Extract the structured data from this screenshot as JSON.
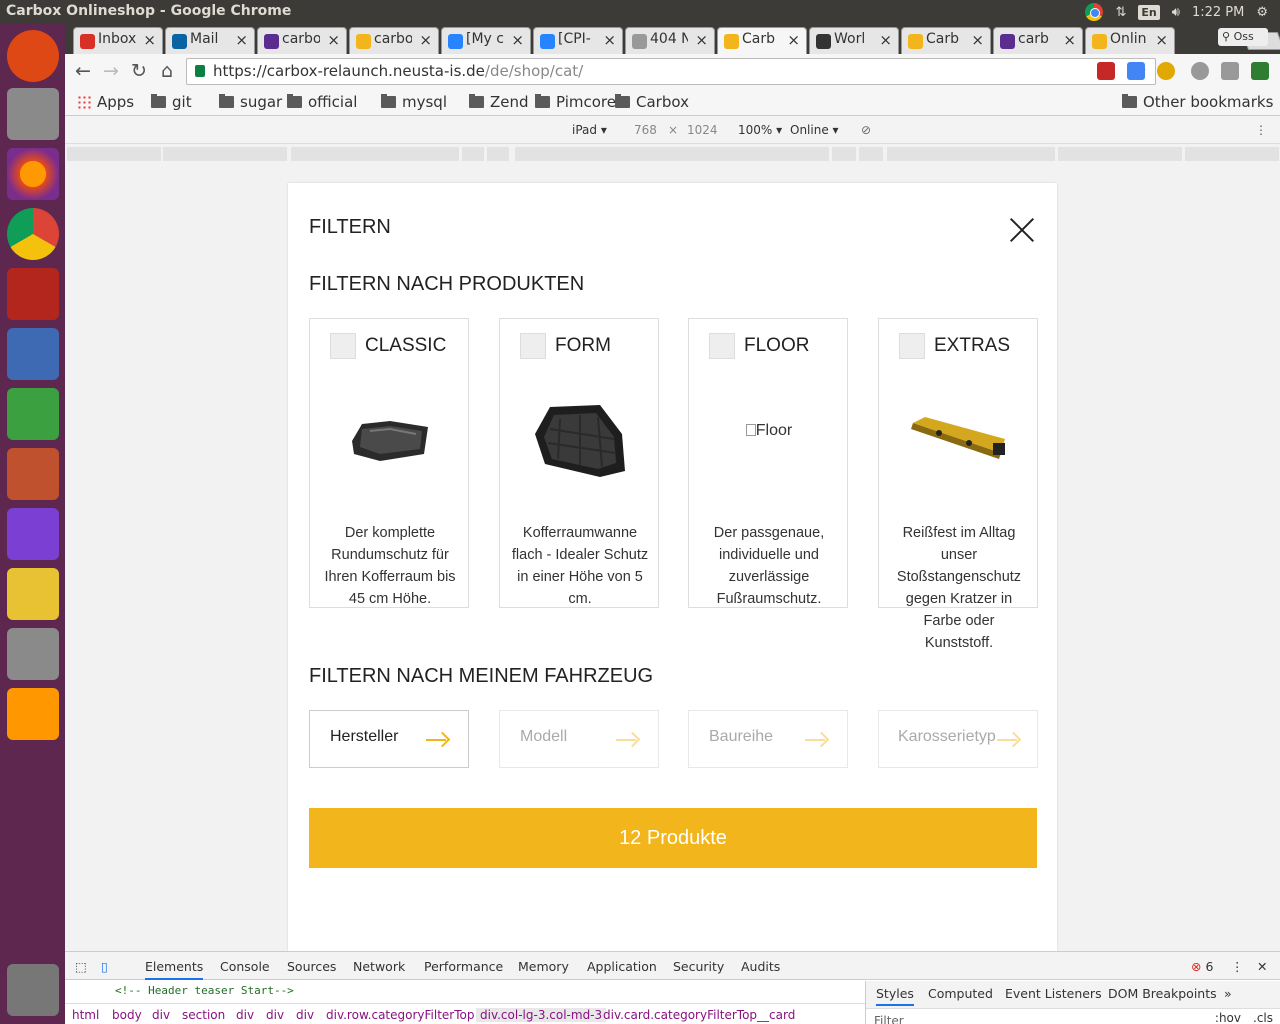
{
  "os": {
    "window_title": "Carbox Onlineshop - Google Chrome",
    "keyboard": "En",
    "time": "1:22 PM"
  },
  "tabs": [
    {
      "label": "Inbox",
      "color": "#d93025"
    },
    {
      "label": "Mail",
      "color": "#0a64a4"
    },
    {
      "label": "carbox",
      "color": "#5c2d91"
    },
    {
      "label": "carbox",
      "color": "#f2b61c"
    },
    {
      "label": "[My c",
      "color": "#2684ff"
    },
    {
      "label": "[CPI-",
      "color": "#2684ff"
    },
    {
      "label": "404 N",
      "color": "#999999"
    },
    {
      "label": "Carb",
      "color": "#f2b61c"
    },
    {
      "label": "Worl",
      "color": "#333333"
    },
    {
      "label": "Carb",
      "color": "#f2b61c"
    },
    {
      "label": "carb",
      "color": "#5c2d91"
    },
    {
      "label": "Onlin",
      "color": "#f2b61c"
    }
  ],
  "profile": "Oss",
  "omnibox": {
    "host": "https://carbox-relaunch.neusta-is.de",
    "path": "/de/shop/cat/"
  },
  "bookmarks": {
    "apps": "Apps",
    "folders": [
      "git",
      "sugar",
      "official",
      "mysql",
      "Zend",
      "Pimcore",
      "Carbox"
    ],
    "other": "Other bookmarks"
  },
  "device_toolbar": {
    "device": "iPad",
    "width": "768",
    "times": "×",
    "height": "1024",
    "zoom": "100%",
    "network": "Online"
  },
  "filter": {
    "title": "FILTERN",
    "products_heading": "FILTERN NACH PRODUKTEN",
    "products": [
      {
        "name": "CLASSIC",
        "description": "Der komplette Rundumschutz für Ihren Kofferraum bis 45 cm Höhe."
      },
      {
        "name": "FORM",
        "description": "Kofferraumwanne flach - Idealer Schutz in einer Höhe von 5 cm."
      },
      {
        "name": "FLOOR",
        "description": "Der passgenaue, individuelle und zuverlässige Fußraumschutz.",
        "alt": "Floor"
      },
      {
        "name": "EXTRAS",
        "description": "Reißfest im Alltag unser Stoßstangenschutz gegen Kratzer in Farbe oder Kunststoff."
      }
    ],
    "vehicle_heading": "FILTERN NACH MEINEM FAHRZEUG",
    "vehicle_selects": [
      "Hersteller",
      "Modell",
      "Baureihe",
      "Karosserietyp"
    ],
    "result_button": "12 Produkte",
    "accent_color": "#f2b61c"
  },
  "devtools": {
    "tabs": [
      "Elements",
      "Console",
      "Sources",
      "Network",
      "Performance",
      "Memory",
      "Application",
      "Security",
      "Audits"
    ],
    "error_count": "6",
    "code_line": "<!-- Header teaser Start-->",
    "breadcrumbs": [
      "html",
      "body",
      "div",
      "section",
      "div",
      "div",
      "div",
      "div.row.categoryFilterTop",
      "div.col-lg-3.col-md-3",
      "div.card.categoryFilterTop__card"
    ],
    "side_tabs": [
      "Styles",
      "Computed",
      "Event Listeners",
      "DOM Breakpoints",
      "»"
    ],
    "filter_placeholder": "Filter",
    "hov": ":hov",
    "cls": ".cls"
  }
}
